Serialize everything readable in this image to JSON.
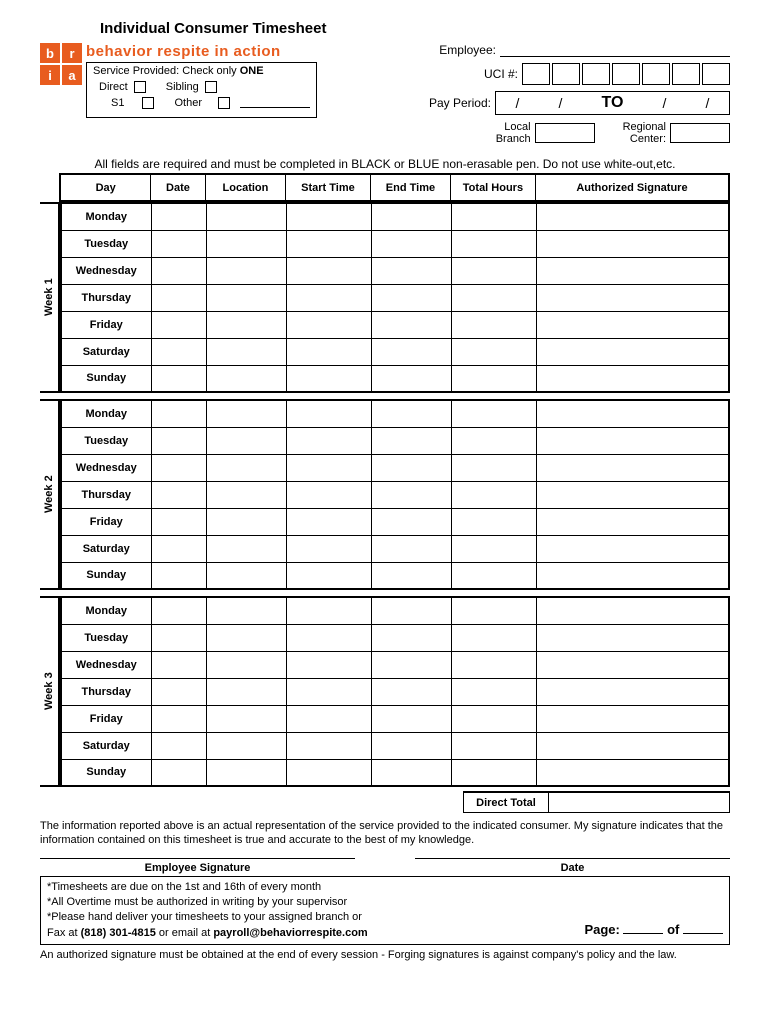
{
  "title": "Individual Consumer Timesheet",
  "brand": "behavior respite in action",
  "logo": {
    "tl": "b",
    "tr": "r",
    "bl": "i",
    "br": "a"
  },
  "service": {
    "title_a": "Service Provided: Check only ",
    "title_b": "ONE",
    "opt_direct": "Direct",
    "opt_sibling": "Sibling",
    "opt_s1": "S1",
    "opt_other": "Other"
  },
  "fields": {
    "employee": "Employee:",
    "uci": "UCI #:",
    "payperiod": "Pay Period:",
    "to": "TO",
    "slash": "/",
    "local_branch_a": "Local",
    "local_branch_b": "Branch",
    "regional_center_a": "Regional",
    "regional_center_b": "Center:"
  },
  "instruction": "All fields are required and must be completed in BLACK or BLUE non-erasable pen. Do not use white-out,etc.",
  "columns": {
    "day": "Day",
    "date": "Date",
    "location": "Location",
    "start": "Start Time",
    "end": "End Time",
    "hours": "Total Hours",
    "sig": "Authorized Signature"
  },
  "weeks": [
    {
      "label": "Week 1",
      "days": [
        "Monday",
        "Tuesday",
        "Wednesday",
        "Thursday",
        "Friday",
        "Saturday",
        "Sunday"
      ]
    },
    {
      "label": "Week 2",
      "days": [
        "Monday",
        "Tuesday",
        "Wednesday",
        "Thursday",
        "Friday",
        "Saturday",
        "Sunday"
      ]
    },
    {
      "label": "Week 3",
      "days": [
        "Monday",
        "Tuesday",
        "Wednesday",
        "Thursday",
        "Friday",
        "Saturday",
        "Sunday"
      ]
    }
  ],
  "direct_total": "Direct Total",
  "disclaimer": "The information reported above is an actual representation of the service provided to the indicated consumer.  My signature indicates that the information contained on this timesheet is true and accurate to the best of my knowledge.",
  "sig": {
    "employee": "Employee Signature",
    "date": "Date"
  },
  "notes": {
    "l1": "*Timesheets are due on the 1st and 16th of every month",
    "l2": "*All Overtime must be authorized in writing by your supervisor",
    "l3": "*Please hand deliver your timesheets to your assigned branch or",
    "l4a": "Fax at ",
    "l4b": "(818) 301-4815",
    "l4c": " or  email at ",
    "l4d": "payroll@behaviorrespite.com"
  },
  "page": {
    "label": "Page:",
    "of": "of"
  },
  "footer": "An authorized signature must be obtained at the end of every session - Forging signatures is against company's policy and the law."
}
